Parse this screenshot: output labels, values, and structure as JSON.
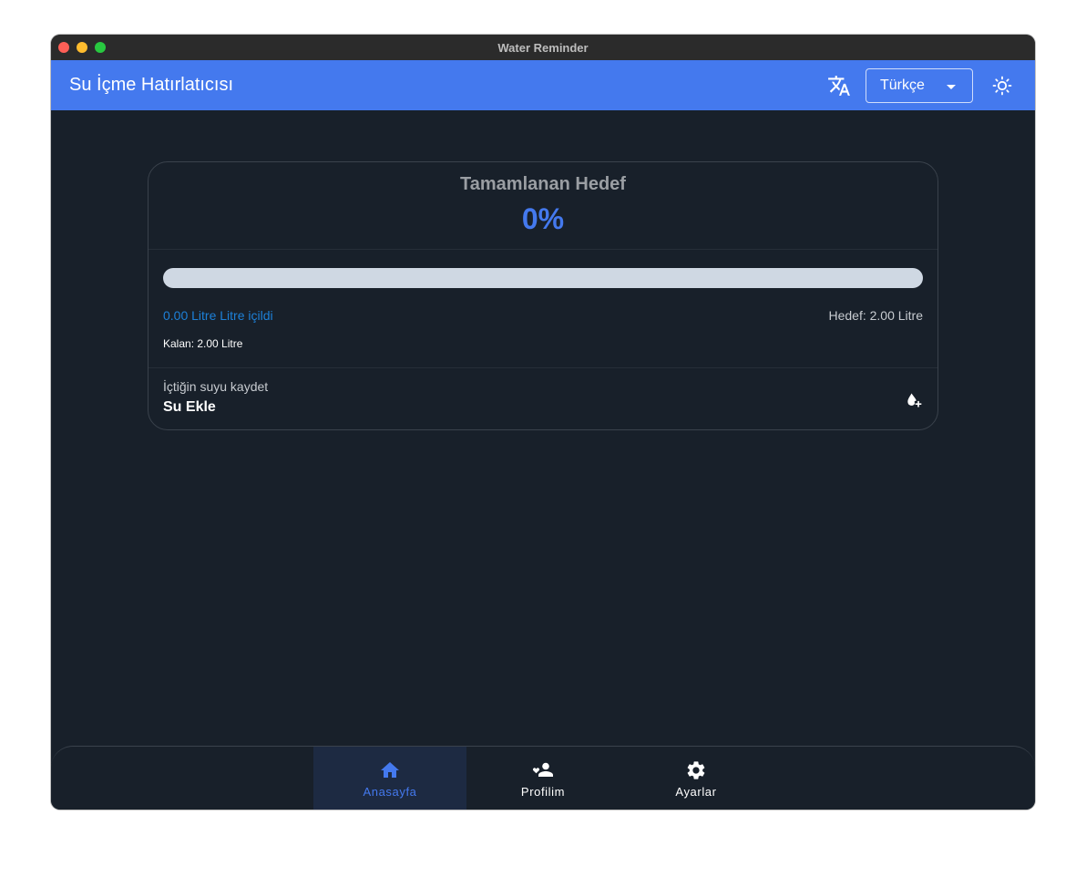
{
  "window": {
    "title": "Water Reminder"
  },
  "appbar": {
    "title": "Su İçme Hatırlatıcısı",
    "language_selected": "Türkçe"
  },
  "card": {
    "title": "Tamamlanan Hedef",
    "percent_label": "0%",
    "progress_fraction": 0.0,
    "drunk": "0.00 Litre Litre içildi",
    "goal": "Hedef: 2.00 Litre",
    "remaining": "Kalan: 2.00 Litre",
    "add_subtitle": "İçtiğin suyu kaydet",
    "add_title": "Su Ekle"
  },
  "nav": {
    "items": [
      {
        "label": "Anasayfa",
        "icon": "home-icon",
        "active": true
      },
      {
        "label": "Profilim",
        "icon": "person-heart-icon",
        "active": false
      },
      {
        "label": "Ayarlar",
        "icon": "gear-icon",
        "active": false
      }
    ]
  },
  "colors": {
    "accent": "#4479ee",
    "background": "#18202a",
    "progress_track": "#cfd8e3",
    "drunk_text": "#1d80d8"
  }
}
